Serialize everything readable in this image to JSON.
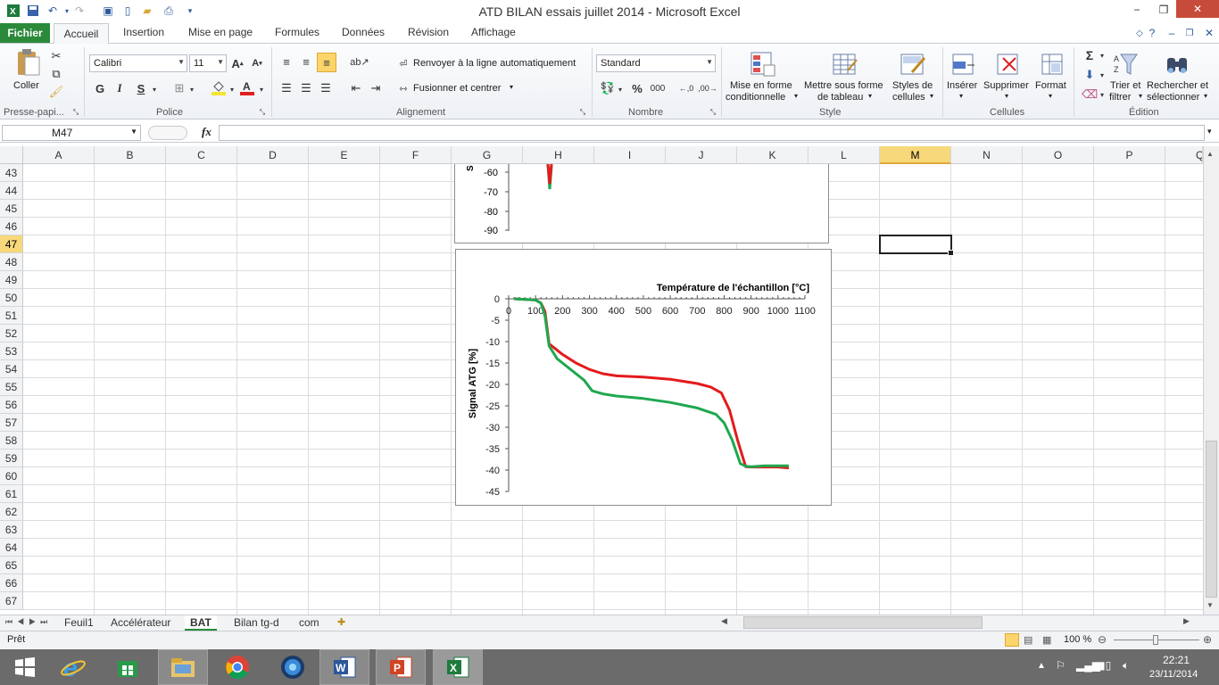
{
  "window": {
    "title": "ATD BILAN essais juillet 2014  -  Microsoft Excel",
    "minimize": "−",
    "restore": "❐",
    "close": "✕"
  },
  "ribbon_tabs": [
    "Accueil",
    "Insertion",
    "Mise en page",
    "Formules",
    "Données",
    "Révision",
    "Affichage"
  ],
  "file_tab": "Fichier",
  "ribbon": {
    "clipboard": {
      "paste": "Coller",
      "label": "Presse-papi..."
    },
    "font": {
      "name": "Calibri",
      "size": "11",
      "bold": "G",
      "italic": "I",
      "underline": "S",
      "label": "Police"
    },
    "alignment": {
      "wrap": "Renvoyer à la ligne automatiquement",
      "merge": "Fusionner et centrer",
      "label": "Alignement"
    },
    "number": {
      "format": "Standard",
      "percent": "%",
      "thousands": "000",
      "label": "Nombre"
    },
    "style": {
      "conditional": [
        "Mise en forme",
        "conditionnelle"
      ],
      "table": [
        "Mettre sous forme",
        "de tableau"
      ],
      "cell_styles": [
        "Styles de",
        "cellules"
      ],
      "label": "Style"
    },
    "cells": {
      "insert": "Insérer",
      "delete": "Supprimer",
      "format": "Format",
      "label": "Cellules"
    },
    "editing": {
      "sort": [
        "Trier et",
        "filtrer"
      ],
      "find": [
        "Rechercher et",
        "sélectionner"
      ],
      "label": "Édition",
      "sum": "Σ"
    }
  },
  "formula_bar": {
    "name_box": "M47",
    "fx": "fx",
    "value": ""
  },
  "columns": [
    "A",
    "B",
    "C",
    "D",
    "E",
    "F",
    "G",
    "H",
    "I",
    "J",
    "K",
    "L",
    "M",
    "N",
    "O",
    "P",
    "Q"
  ],
  "rows": [
    "43",
    "44",
    "45",
    "46",
    "47",
    "48",
    "49",
    "50",
    "51",
    "52",
    "53",
    "54",
    "55",
    "56",
    "57",
    "58",
    "59",
    "60",
    "61",
    "62",
    "63",
    "64",
    "65",
    "66",
    "67"
  ],
  "selected": {
    "column": "M",
    "row": "47"
  },
  "sheets": [
    "Feuil1",
    "Accélérateur",
    "BAT",
    "Bilan tg-d",
    "com"
  ],
  "active_sheet": "BAT",
  "status": {
    "text": "Prêt",
    "zoom": "100 %"
  },
  "taskbar": {
    "time": "22:21",
    "date": "23/11/2014"
  },
  "chart_top": {
    "y_ticks": [
      "-60",
      "-70",
      "-80",
      "-90"
    ],
    "ylabel_partial": "S"
  },
  "chart_data": {
    "type": "line",
    "title": "",
    "xlabel": "Température de l'échantillon  [°C]",
    "ylabel": "Signal ATG [%]",
    "xlim": [
      0,
      1100
    ],
    "ylim": [
      -45,
      0
    ],
    "x_ticks": [
      "0",
      "100",
      "200",
      "300",
      "400",
      "500",
      "600",
      "700",
      "800",
      "900",
      "1000",
      "1100"
    ],
    "y_ticks": [
      "0",
      "-5",
      "-10",
      "-15",
      "-20",
      "-25",
      "-30",
      "-35",
      "-40",
      "-45"
    ],
    "legend": "none",
    "series": [
      {
        "color": "#e41a1c",
        "points": [
          [
            20,
            0
          ],
          [
            100,
            -0.3
          ],
          [
            120,
            -1
          ],
          [
            135,
            -3
          ],
          [
            150,
            -10.5
          ],
          [
            200,
            -13
          ],
          [
            250,
            -15
          ],
          [
            300,
            -16.5
          ],
          [
            350,
            -17.5
          ],
          [
            400,
            -18
          ],
          [
            500,
            -18.3
          ],
          [
            600,
            -18.8
          ],
          [
            700,
            -19.8
          ],
          [
            750,
            -20.6
          ],
          [
            790,
            -22
          ],
          [
            820,
            -26
          ],
          [
            850,
            -33
          ],
          [
            880,
            -39.2
          ],
          [
            900,
            -39.3
          ],
          [
            1000,
            -39.3
          ],
          [
            1040,
            -39.5
          ]
        ]
      },
      {
        "color": "#1fa84f",
        "points": [
          [
            20,
            0
          ],
          [
            100,
            -0.3
          ],
          [
            120,
            -1
          ],
          [
            135,
            -4
          ],
          [
            150,
            -11
          ],
          [
            180,
            -14
          ],
          [
            230,
            -16.5
          ],
          [
            280,
            -19
          ],
          [
            310,
            -21.5
          ],
          [
            350,
            -22.2
          ],
          [
            400,
            -22.7
          ],
          [
            500,
            -23.3
          ],
          [
            600,
            -24.2
          ],
          [
            700,
            -25.5
          ],
          [
            770,
            -27
          ],
          [
            800,
            -29
          ],
          [
            830,
            -33
          ],
          [
            860,
            -38.5
          ],
          [
            880,
            -39.1
          ],
          [
            900,
            -39.2
          ],
          [
            950,
            -39
          ],
          [
            1040,
            -39
          ]
        ]
      }
    ]
  }
}
